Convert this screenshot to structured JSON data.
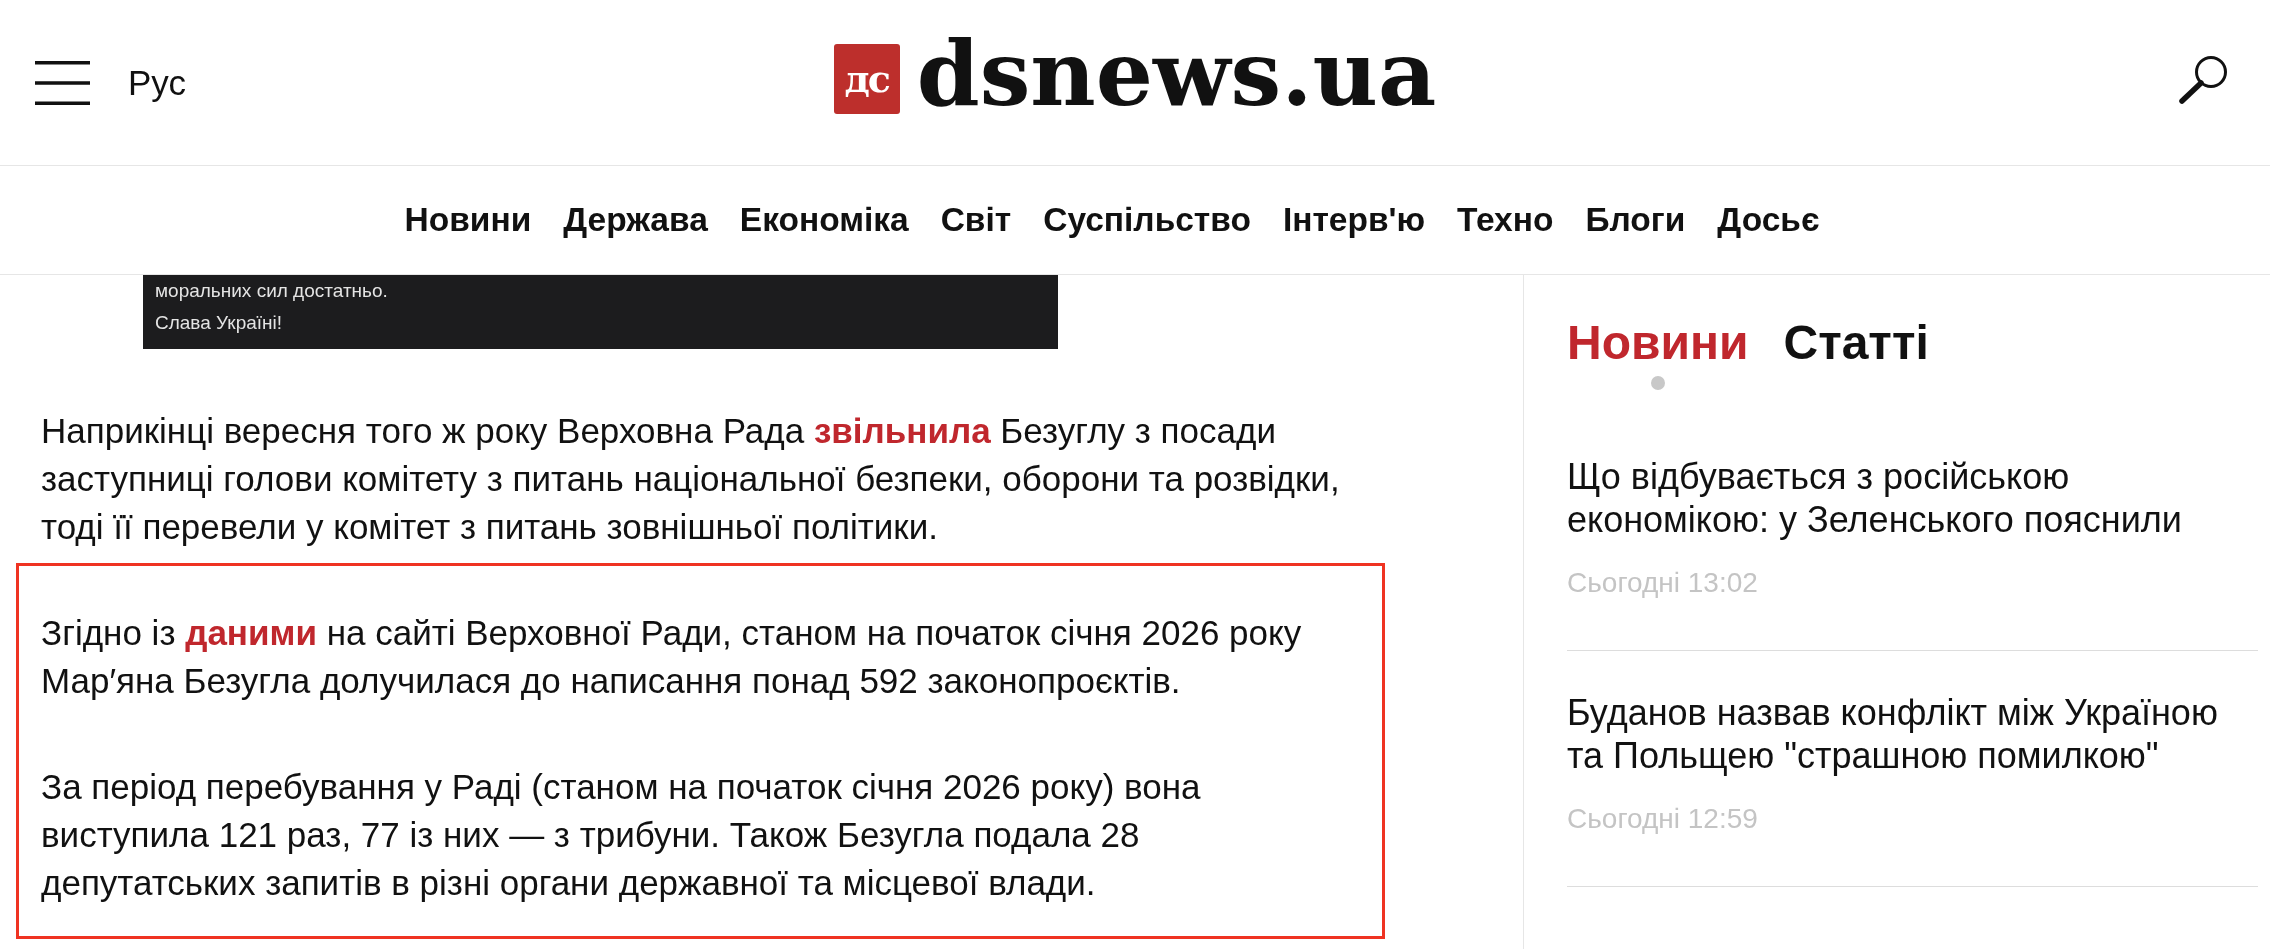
{
  "header": {
    "language": "Рус",
    "logo": {
      "mark": "дс",
      "text": "dsnews.ua"
    }
  },
  "nav": {
    "items": [
      "Новини",
      "Держава",
      "Економіка",
      "Світ",
      "Суспільство",
      "Інтерв'ю",
      "Техно",
      "Блоги",
      "Досьє"
    ]
  },
  "article": {
    "embed": {
      "lines": [
        "моральних сил достатньо.",
        "Слава Україні!"
      ]
    },
    "blocks": [
      {
        "kind": "plain",
        "paragraphs": [
          {
            "segments": [
              {
                "kind": "text",
                "text": "Наприкінці вересня того ж року Верховна Рада "
              },
              {
                "kind": "link",
                "text": "звільнила"
              },
              {
                "kind": "text",
                "text": " Безуглу з посади заступниці голови комітету з питань національної безпеки, оборони та розвідки, тоді її перевели у комітет з питань зовнішньої політики."
              }
            ]
          }
        ]
      },
      {
        "kind": "framed",
        "paragraphs": [
          {
            "segments": [
              {
                "kind": "text",
                "text": "Згідно із "
              },
              {
                "kind": "link",
                "text": "даними"
              },
              {
                "kind": "text",
                "text": " на сайті Верховної Ради, станом на початок січня 2026 року Мар′яна Безугла долучилася до написання понад 592 законопроєктів."
              }
            ]
          },
          {
            "segments": [
              {
                "kind": "text",
                "text": "За період перебування у Раді (станом на початок січня 2026 року) вона виступила 121 раз, 77 із них — з трибуни. Також Безугла подала 28 депутатських запитів в різні органи державної та місцевої влади."
              }
            ]
          }
        ]
      }
    ]
  },
  "sidebar": {
    "tabs": [
      {
        "label": "Новини",
        "selected": true
      },
      {
        "label": "Статті",
        "selected": false
      }
    ],
    "items": [
      {
        "title": "Що відбувається з російською економікою: у Зеленського пояснили",
        "time": "Сьогодні 13:02"
      },
      {
        "title": "Буданов назвав конфлікт між Україною та Польщею \"страшною помилкою\"",
        "time": "Сьогодні 12:59"
      }
    ]
  }
}
